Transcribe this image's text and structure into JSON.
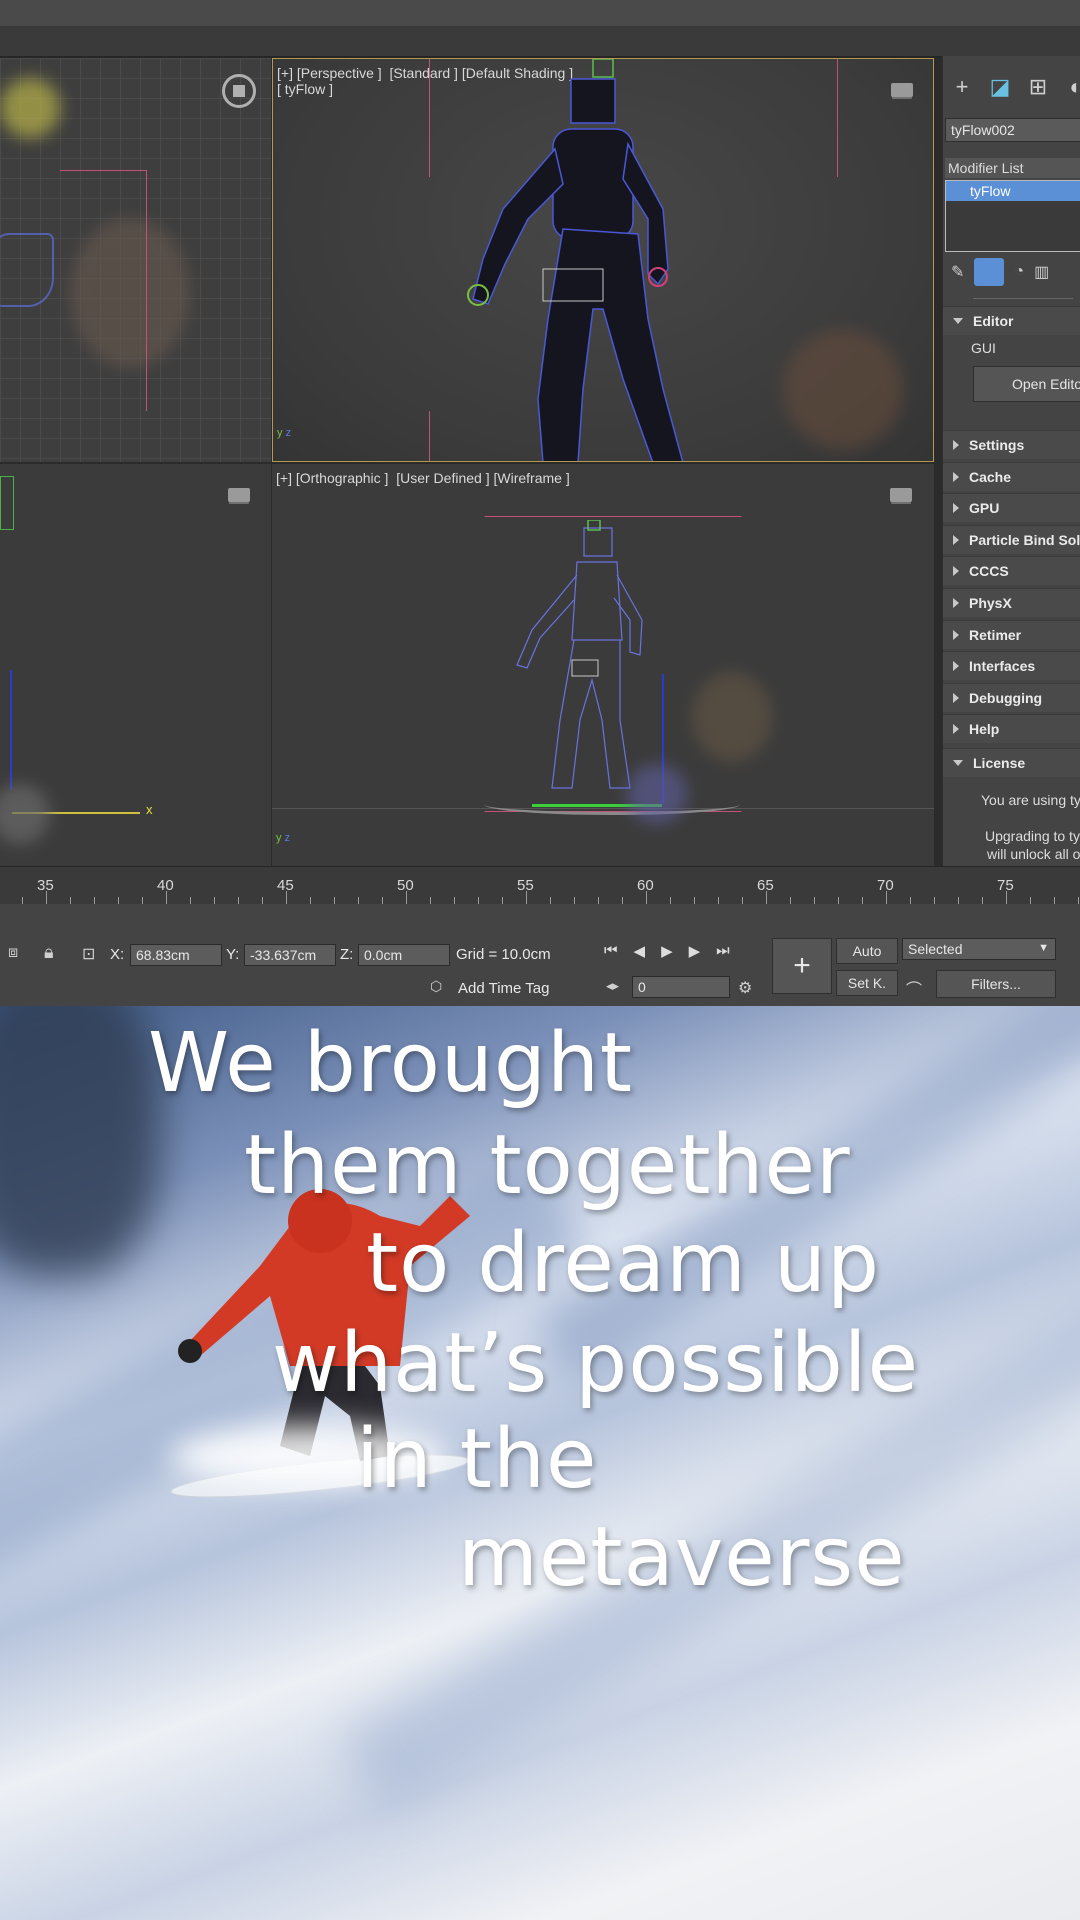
{
  "viewports": {
    "perspective_label": "[+] [Perspective ]  [Standard ] [Default Shading ]",
    "perspective_sub": "[ tyFlow ]",
    "ortho_label": "[+] [Orthographic ]  [User Defined ] [Wireframe ]",
    "axis_x": "x",
    "axis_y": "y",
    "axis_z": "z"
  },
  "panel": {
    "object_name": "tyFlow002",
    "modifier_list_label": "Modifier List",
    "modifier_item": "tyFlow",
    "editor_rollout": "Editor",
    "gui_label": "GUI",
    "open_editor": "Open Editor",
    "rollouts": [
      "Settings",
      "Cache",
      "GPU",
      "Particle Bind Solver",
      "CCCS",
      "PhysX",
      "Retimer",
      "Interfaces",
      "Debugging",
      "Help"
    ],
    "license_rollout": "License",
    "license_text_1": "You are using tyFlow",
    "license_text_2": "Upgrading to tyFlow",
    "license_text_3": "will unlock all of"
  },
  "timeline": {
    "ticks": [
      "35",
      "40",
      "45",
      "50",
      "55",
      "60",
      "65",
      "70",
      "75"
    ]
  },
  "statusbar": {
    "x_label": "X:",
    "x_value": "68.83cm",
    "y_label": "Y:",
    "y_value": "-33.637cm",
    "z_label": "Z:",
    "z_value": "0.0cm",
    "grid_text": "Grid = 10.0cm",
    "add_time_tag": "Add Time Tag",
    "frame_value": "0",
    "auto_label": "Auto",
    "setk_label": "Set K.",
    "selected_option": "Selected",
    "filters_label": "Filters..."
  },
  "caption": {
    "line1": "We brought",
    "line2": "them together",
    "line3": "to dream up",
    "line4": "what’s possible",
    "line5": "in the",
    "line6": "metaverse"
  },
  "colors": {
    "viewport_border": "#b39a52",
    "selection_blue": "#5b8fd6",
    "jacket_red": "#d23a26"
  }
}
